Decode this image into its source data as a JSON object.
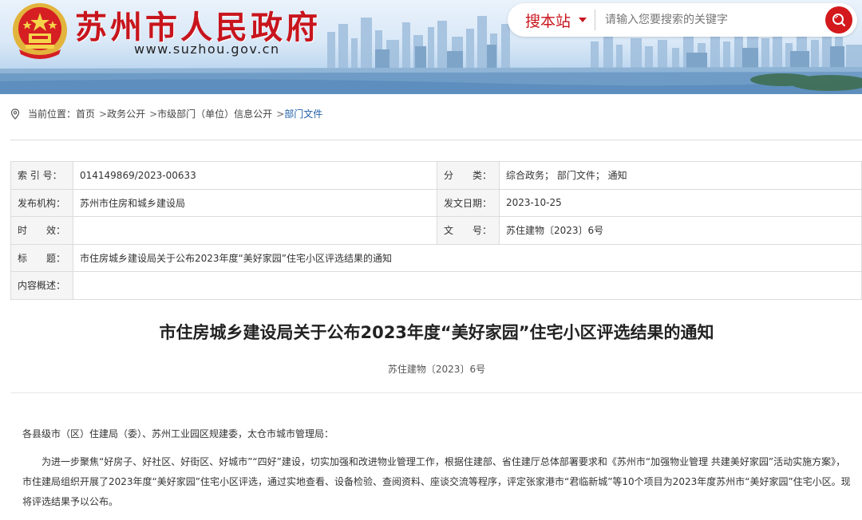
{
  "header": {
    "site_title": "苏州市人民政府",
    "site_url": "www.suzhou.gov.cn",
    "search": {
      "scope_label": "搜本站",
      "placeholder": "请输入您要搜索的关键字"
    }
  },
  "breadcrumb": {
    "label": "当前位置：",
    "items": [
      "首页",
      "政务公开",
      "市级部门（单位）信息公开",
      "部门文件"
    ],
    "separator": ">"
  },
  "meta": {
    "rows": [
      {
        "label1": "索 引 号：",
        "value1": "014149869/2023-00633",
        "label2": "分　　类：",
        "value2": "综合政务； 部门文件； 通知"
      },
      {
        "label1": "发布机构：",
        "value1": "苏州市住房和城乡建设局",
        "label2": "发文日期：",
        "value2": "2023-10-25"
      },
      {
        "label1": "时　　效：",
        "value1": "",
        "label2": "文　　号：",
        "value2": "苏住建物〔2023〕6号"
      }
    ],
    "title_label": "标　　题：",
    "title_value": "市住房城乡建设局关于公布2023年度“美好家园”住宅小区评选结果的通知",
    "summary_label": "内容概述：",
    "summary_value": ""
  },
  "article": {
    "title": "市住房城乡建设局关于公布2023年度“美好家园”住宅小区评选结果的通知",
    "doc_number": "苏住建物〔2023〕6号",
    "addressee": "各县级市（区）住建局（委）、苏州工业园区规建委，太仓市城市管理局：",
    "paragraph": "为进一步聚焦“好房子、好社区、好街区、好城市”“四好”建设，切实加强和改进物业管理工作，根据住建部、省住建厅总体部署要求和《苏州市“加强物业管理 共建美好家园”活动实施方案》，市住建局组织开展了2023年度“美好家园”住宅小区评选，通过实地查看、设备检验、查阅资料、座谈交流等程序，评定张家港市“君临新城”等10个项目为2023年度苏州市“美好家园”住宅小区。现将评选结果予以公布。"
  },
  "colors": {
    "brand_red": "#c8151d",
    "link_blue": "#1f5fa8"
  }
}
